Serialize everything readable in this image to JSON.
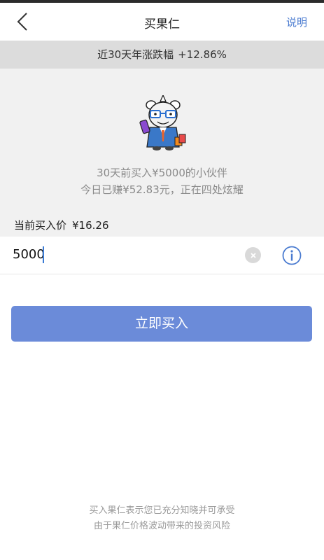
{
  "nav": {
    "title": "买果仁",
    "help_label": "说明"
  },
  "banner": {
    "label": "近30天年涨跌幅",
    "change": "+12.86%"
  },
  "info": {
    "line1": "30天前买入¥5000的小伙伴",
    "line2": "今日已赚¥52.83元，正在四处炫耀"
  },
  "price": {
    "label": "当前买入价",
    "value": "¥16.26"
  },
  "amount_input": {
    "value": "5000"
  },
  "buy_button": {
    "label": "立即买入"
  },
  "footer": {
    "line1": "买入果仁表示您已充分知晓并可承受",
    "line2": "由于果仁价格波动带来的投资风险"
  },
  "colors": {
    "accent": "#4a7bd0",
    "button": "#6b8bd9",
    "banner_bg": "#dcdcdc",
    "info_bg": "#f1f1f1"
  },
  "icons": {
    "back": "chevron-left-icon",
    "clear": "clear-icon",
    "info": "info-icon",
    "mascot": "rhino-mascot"
  }
}
